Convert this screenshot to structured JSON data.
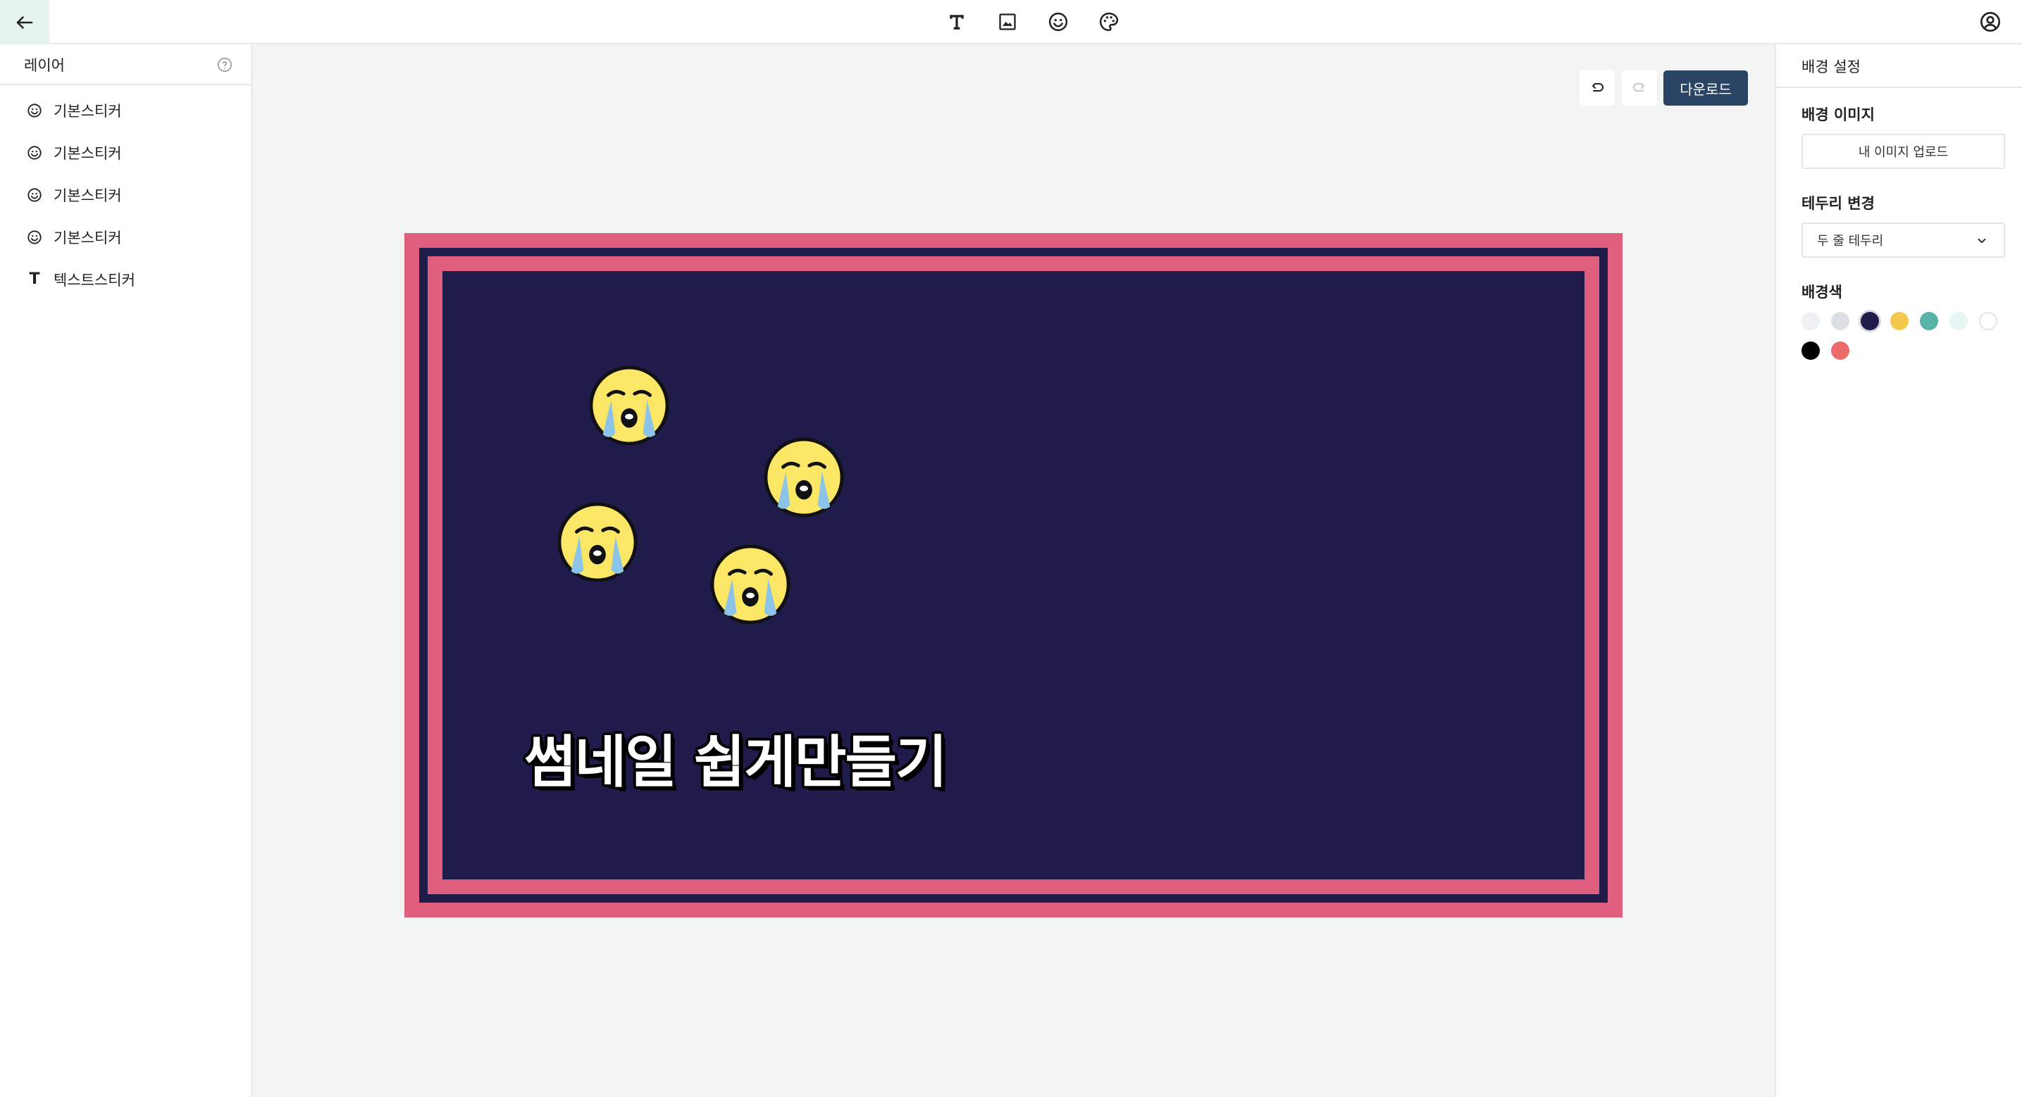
{
  "toolbar": {
    "back_icon": "arrow-left-icon",
    "tools": [
      {
        "name": "text-tool",
        "icon": "text-icon"
      },
      {
        "name": "image-tool",
        "icon": "image-icon"
      },
      {
        "name": "sticker-tool",
        "icon": "smiley-icon"
      },
      {
        "name": "palette-tool",
        "icon": "palette-icon"
      }
    ],
    "profile_icon": "user-circle-icon"
  },
  "layers": {
    "title": "레이어",
    "items": [
      {
        "label": "기본스티커",
        "icon": "smiley-icon"
      },
      {
        "label": "기본스티커",
        "icon": "smiley-icon"
      },
      {
        "label": "기본스티커",
        "icon": "smiley-icon"
      },
      {
        "label": "기본스티커",
        "icon": "smiley-icon"
      },
      {
        "label": "텍스트스티커",
        "icon": "text-icon",
        "glyph": "T"
      }
    ]
  },
  "canvas": {
    "download_label": "다운로드",
    "title_text": "썸네일 쉽게만들기",
    "background_color": "#1f1b4b",
    "border_color": "#e05f7e",
    "sticker_emoji": "crying-face"
  },
  "settings": {
    "title": "배경 설정",
    "bg_image_label": "배경 이미지",
    "upload_label": "내 이미지 업로드",
    "border_label": "테두리 변경",
    "border_value": "두 줄 테두리",
    "color_label": "배경색",
    "colors": [
      "#eef1f4",
      "#dcdfe3",
      "#1f1b4b",
      "#f2c94c",
      "#56b3a6",
      "#e8f6f3",
      "#ffffff",
      "#000000",
      "#eb6b6b"
    ],
    "selected_color": "#1f1b4b"
  }
}
